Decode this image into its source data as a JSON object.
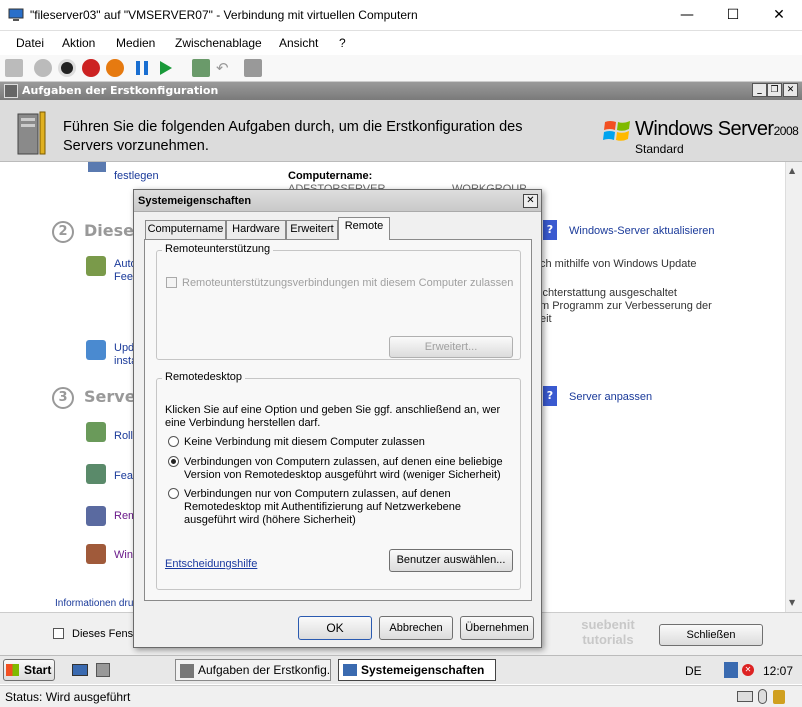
{
  "window": {
    "title": "\"fileserver03\" auf \"VMSERVER07\" - Verbindung mit virtuellen Computern",
    "minimize": "—",
    "maximize": "☐",
    "close": "✕"
  },
  "menu": [
    "Datei",
    "Aktion",
    "Medien",
    "Zwischenablage",
    "Ansicht",
    "?"
  ],
  "ict": {
    "title": "Aufgaben der Erstkonfiguration",
    "banner": "Führen Sie die folgenden Aufgaben durch, um die Erstkonfiguration des Servers vorzunehmen.",
    "brand": "Windows Server",
    "brand_version": "2008",
    "edition": "Standard",
    "bg": {
      "festlegen": "festlegen",
      "computername": "Computername:",
      "computername_val": "ADFSTORSERVER",
      "workgroup": "WORKGROUP",
      "sec2_num": "2",
      "sec2": "Dieser",
      "auto": "Auto",
      "feed": "Feed",
      "upd": "Upd",
      "insta": "insta",
      "windows_update_link": "Windows-Server aktualisieren",
      "update_text": "ch mithilfe von Windows Update",
      "feedback1": "ichterstattung ausgeschaltet",
      "feedback2": "m Programm zur Verbesserung der",
      "feedback3": "eit",
      "sec3_num": "3",
      "sec3": "Server",
      "roll": "Roll",
      "feat": "Feat",
      "rem": "Rem",
      "win": "Win",
      "anpassen_link": "Server anpassen",
      "info": "Informationen dru",
      "dieses": "Dieses Fenst",
      "close_btn": "Schließen"
    }
  },
  "watermark": [
    "suebenit",
    "tutorials"
  ],
  "dialog": {
    "title": "Systemeigenschaften",
    "close": "✕",
    "tabs": [
      "Computername",
      "Hardware",
      "Erweitert",
      "Remote"
    ],
    "active_tab": 3,
    "remote_assist": {
      "legend": "Remoteunterstützung",
      "checkbox": "Remoteunterstützungsverbindungen mit diesem Computer zulassen",
      "advanced": "Erweitert..."
    },
    "remote_desktop": {
      "legend": "Remotedesktop",
      "intro": "Klicken Sie auf eine Option und geben Sie ggf. anschließend an, wer eine Verbindung herstellen darf.",
      "opt1": "Keine Verbindung mit diesem Computer zulassen",
      "opt2": "Verbindungen von Computern zulassen, auf denen eine beliebige Version von Remotedesktop ausgeführt wird (weniger Sicherheit)",
      "opt3": "Verbindungen nur von Computern zulassen, auf denen Remotedesktop mit Authentifizierung auf Netzwerkebene ausgeführt wird (höhere Sicherheit)",
      "selected": 2,
      "help_link": "Entscheidungshilfe",
      "select_users": "Benutzer auswählen..."
    },
    "ok": "OK",
    "cancel": "Abbrechen",
    "apply": "Übernehmen"
  },
  "taskbar": {
    "start": "Start",
    "task1": "Aufgaben der Erstkonfig...",
    "task2": "Systemeigenschaften",
    "lang": "DE",
    "clock": "12:07"
  },
  "status": "Status: Wird ausgeführt"
}
